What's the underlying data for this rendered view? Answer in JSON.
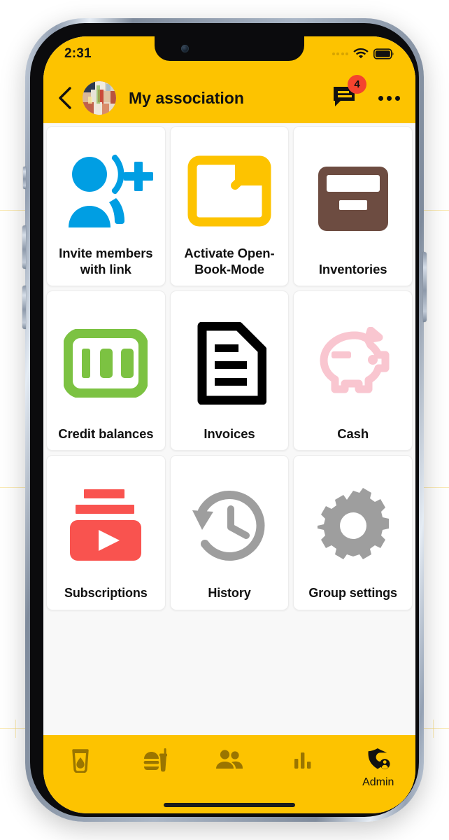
{
  "device": {
    "frame": "iphone-silver",
    "notch": true,
    "home_indicator": true
  },
  "status_bar": {
    "time": "2:31",
    "signal_icon": "signal-dots-icon",
    "wifi_icon": "wifi-icon",
    "battery_icon": "battery-full-icon",
    "background_color": "#fdc300"
  },
  "app_bar": {
    "back_icon": "back-chevron-icon",
    "avatar_icon": "group-photo-avatar",
    "title": "My association",
    "messages_icon": "chat-bubble-icon",
    "messages_badge": "4",
    "badge_color": "#f4442e",
    "overflow_icon": "more-horizontal-icon",
    "background_color": "#fdc300"
  },
  "grid": {
    "background_color": "#f8f8f8",
    "tiles": [
      {
        "label": "Invite members with link",
        "icon": "person-add-icon",
        "color": "#009ee3"
      },
      {
        "label": "Activate Open-Book-Mode",
        "icon": "open-folder-icon",
        "color": "#fdc300"
      },
      {
        "label": "Inventories",
        "icon": "archive-box-icon",
        "color": "#6d4c41"
      },
      {
        "label": "Credit balances",
        "icon": "money-100-icon",
        "color": "#7cc242"
      },
      {
        "label": "Invoices",
        "icon": "document-lines-icon",
        "color": "#000000"
      },
      {
        "label": "Cash",
        "icon": "piggy-bank-icon",
        "color": "#f9c6d0"
      },
      {
        "label": "Subscriptions",
        "icon": "subscriptions-play-icon",
        "color": "#f9534f"
      },
      {
        "label": "History",
        "icon": "history-clock-icon",
        "color": "#9e9e9e"
      },
      {
        "label": "Group settings",
        "icon": "gear-icon",
        "color": "#9e9e9e"
      }
    ]
  },
  "bottom_nav": {
    "background_color": "#fdc300",
    "icon_color": "#9a7500",
    "active_color": "#111111",
    "items": [
      {
        "icon": "drink-glass-icon",
        "label": "",
        "active": false
      },
      {
        "icon": "fast-food-icon",
        "label": "",
        "active": false
      },
      {
        "icon": "people-group-icon",
        "label": "",
        "active": false
      },
      {
        "icon": "bar-chart-icon",
        "label": "",
        "active": false
      },
      {
        "icon": "admin-shield-icon",
        "label": "Admin",
        "active": true
      }
    ]
  }
}
